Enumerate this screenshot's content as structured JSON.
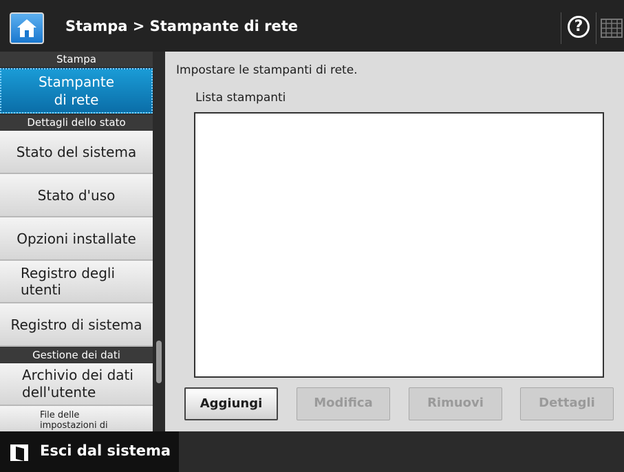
{
  "header": {
    "home_icon": "home-icon",
    "breadcrumb": "Stampa > Stampante di rete",
    "help_icon": "help-icon",
    "help_glyph": "?",
    "keyboard_icon": "keyboard-icon"
  },
  "sidebar": {
    "sections": [
      {
        "title": "Stampa",
        "items": [
          {
            "label": "Stampante\ndi rete",
            "active": true
          }
        ]
      },
      {
        "title": "Dettagli dello stato",
        "items": [
          {
            "label": "Stato del sistema"
          },
          {
            "label": "Stato d'uso"
          },
          {
            "label": "Opzioni installate"
          },
          {
            "label": "Registro degli utenti"
          },
          {
            "label": "Registro di sistema"
          }
        ]
      },
      {
        "title": "Gestione dei dati",
        "items": [
          {
            "label": "Archivio dei dati dell'utente"
          },
          {
            "label": "File delle impostazioni di"
          }
        ]
      }
    ]
  },
  "main": {
    "instruction": "Impostare le stampanti di rete.",
    "list_label": "Lista stampanti",
    "printers": [],
    "buttons": {
      "add": "Aggiungi",
      "edit": "Modifica",
      "remove": "Rimuovi",
      "details": "Dettagli"
    }
  },
  "footer": {
    "logout_icon": "logout-icon",
    "logout_label": "Esci dal sistema"
  },
  "colors": {
    "header_bg": "#232323",
    "active_item": "#0b6ea8",
    "main_bg": "#dcdcdc"
  }
}
